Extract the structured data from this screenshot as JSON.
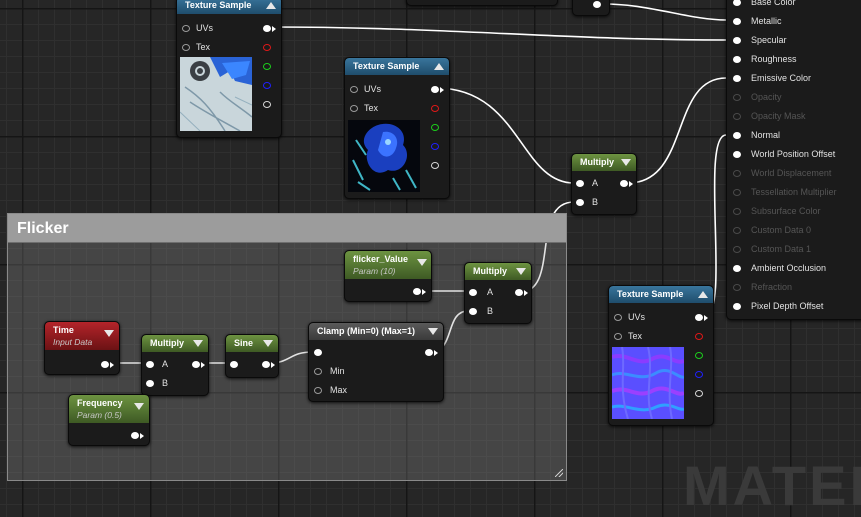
{
  "comment_box": {
    "title": "Flicker"
  },
  "nodes": {
    "texture_sample_a": {
      "title": "Texture Sample",
      "inputs": [
        "UVs",
        "Tex"
      ]
    },
    "texture_sample_b": {
      "title": "Texture Sample",
      "inputs": [
        "UVs",
        "Tex"
      ]
    },
    "texture_sample_c": {
      "title": "Texture Sample",
      "inputs": [
        "UVs",
        "Tex"
      ]
    },
    "multiply_top": {
      "title": "Multiply",
      "inputs": [
        "A",
        "B"
      ]
    },
    "multiply_flicker": {
      "title": "Multiply",
      "inputs": [
        "A",
        "B"
      ]
    },
    "multiply_time": {
      "title": "Multiply",
      "inputs": [
        "A",
        "B"
      ]
    },
    "flicker_value": {
      "title": "flicker_Value",
      "subtitle": "Param (10)"
    },
    "time": {
      "title": "Time",
      "subtitle": "Input Data"
    },
    "frequency": {
      "title": "Frequency",
      "subtitle": "Param (0.5)"
    },
    "sine": {
      "title": "Sine"
    },
    "clamp": {
      "title": "Clamp (Min=0) (Max=1)",
      "inputs": [
        "Min",
        "Max"
      ]
    }
  },
  "material_node": {
    "pins": [
      {
        "label": "Base Color",
        "enabled": true
      },
      {
        "label": "Metallic",
        "enabled": true
      },
      {
        "label": "Specular",
        "enabled": true
      },
      {
        "label": "Roughness",
        "enabled": true
      },
      {
        "label": "Emissive Color",
        "enabled": true
      },
      {
        "label": "Opacity",
        "enabled": false
      },
      {
        "label": "Opacity Mask",
        "enabled": false
      },
      {
        "label": "Normal",
        "enabled": true
      },
      {
        "label": "World Position Offset",
        "enabled": true
      },
      {
        "label": "World Displacement",
        "enabled": false
      },
      {
        "label": "Tessellation Multiplier",
        "enabled": false
      },
      {
        "label": "Subsurface Color",
        "enabled": false
      },
      {
        "label": "Custom Data 0",
        "enabled": false
      },
      {
        "label": "Custom Data 1",
        "enabled": false
      },
      {
        "label": "Ambient Occlusion",
        "enabled": true
      },
      {
        "label": "Refraction",
        "enabled": false
      },
      {
        "label": "Pixel Depth Offset",
        "enabled": true
      }
    ]
  },
  "watermark": "MATER",
  "colors": {
    "pin_red": "#e01818",
    "pin_green": "#1ccf1c",
    "pin_blue": "#2020ff",
    "header_blue": "#2b6187",
    "header_green": "#5a7d35",
    "header_red": "#9c1c20"
  }
}
